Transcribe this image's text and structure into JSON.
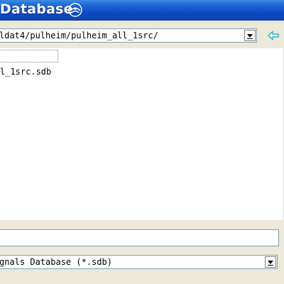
{
  "window": {
    "title": "Database",
    "title_icon": "app-logo-icon"
  },
  "path_bar": {
    "value": "ldat4/pulheim/pulheim_all_1src/",
    "dropdown_icon": "chevron-down-icon",
    "back_icon": "back-arrow-icon"
  },
  "file_list": {
    "items": [
      {
        "label": "l_1src.sdb"
      }
    ]
  },
  "filename_field": {
    "value": ""
  },
  "filetype": {
    "selected": "gnals Database (*.sdb)",
    "dropdown_icon": "chevron-down-icon"
  },
  "colors": {
    "titlebar": "#0a48c2",
    "back_arrow": "#2fb8c8"
  }
}
